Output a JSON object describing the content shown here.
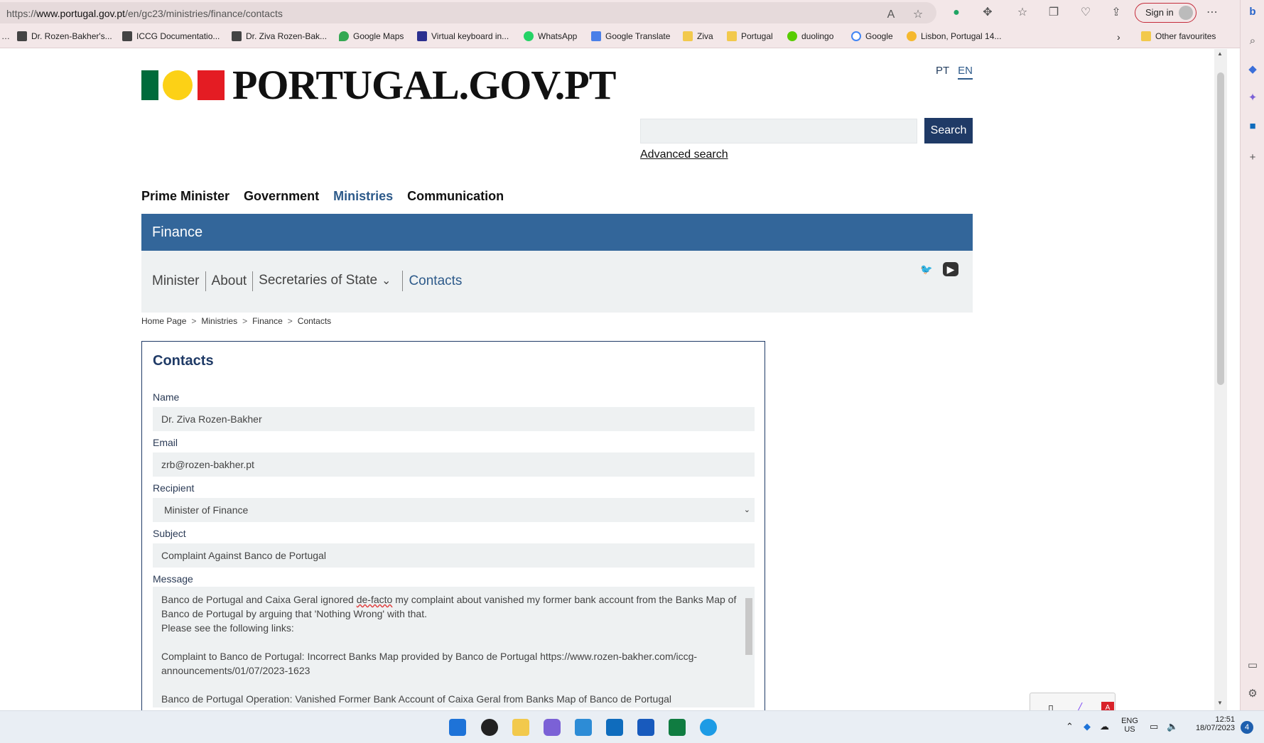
{
  "browser": {
    "url_prefix": "https://",
    "url_domain": "www.portugal.gov.pt",
    "url_path": "/en/gc23/ministries/finance/contacts",
    "signin_label": "Sign in",
    "bookmarks": [
      "Dr. Rozen-Bakher's...",
      "ICCG Documentatio...",
      "Dr. Ziva Rozen-Bak...",
      "Google Maps",
      "Virtual keyboard in...",
      "WhatsApp",
      "Google Translate",
      "Ziva",
      "Portugal",
      "duolingo",
      "Google",
      "Lisbon, Portugal 14..."
    ],
    "other_favourites": "Other favourites"
  },
  "site": {
    "logo_text": "PORTUGAL.GOV.PT",
    "lang_pt": "PT",
    "lang_en": "EN",
    "search_button": "Search",
    "advanced_search": "Advanced search",
    "nav": [
      "Prime Minister",
      "Government",
      "Ministries",
      "Communication"
    ],
    "section_title": "Finance",
    "subnav": [
      "Minister",
      "About",
      "Secretaries of State",
      "Contacts"
    ],
    "breadcrumbs": [
      "Home Page",
      "Ministries",
      "Finance",
      "Contacts"
    ]
  },
  "form": {
    "title": "Contacts",
    "name_label": "Name",
    "name_value": "Dr. Ziva Rozen-Bakher",
    "email_label": "Email",
    "email_value": "zrb@rozen-bakher.pt",
    "recipient_label": "Recipient",
    "recipient_value": "Minister of Finance",
    "subject_label": "Subject",
    "subject_value": "Complaint Against Banco de Portugal",
    "message_label": "Message",
    "message_p1a": "Banco de Portugal and Caixa Geral ignored ",
    "message_p1b": "de-facto",
    "message_p1c": " my complaint about vanished my former bank account from the Banks Map of Banco de Portugal by arguing that 'Nothing Wrong' with that.",
    "message_p2": "Please see the following links:",
    "message_p3": "Complaint to Banco de Portugal: Incorrect Banks Map provided by Banco de Portugal https://www.rozen-bakher.com/iccg-announcements/01/07/2023-1623",
    "message_p4": "Banco de Portugal Operation: Vanished Former Bank Account of Caixa Geral from Banks Map of Banco de Portugal"
  },
  "taskbar": {
    "lang_top": "ENG",
    "lang_bottom": "US",
    "time": "12:51",
    "date": "18/07/2023",
    "notif_count": "4"
  }
}
